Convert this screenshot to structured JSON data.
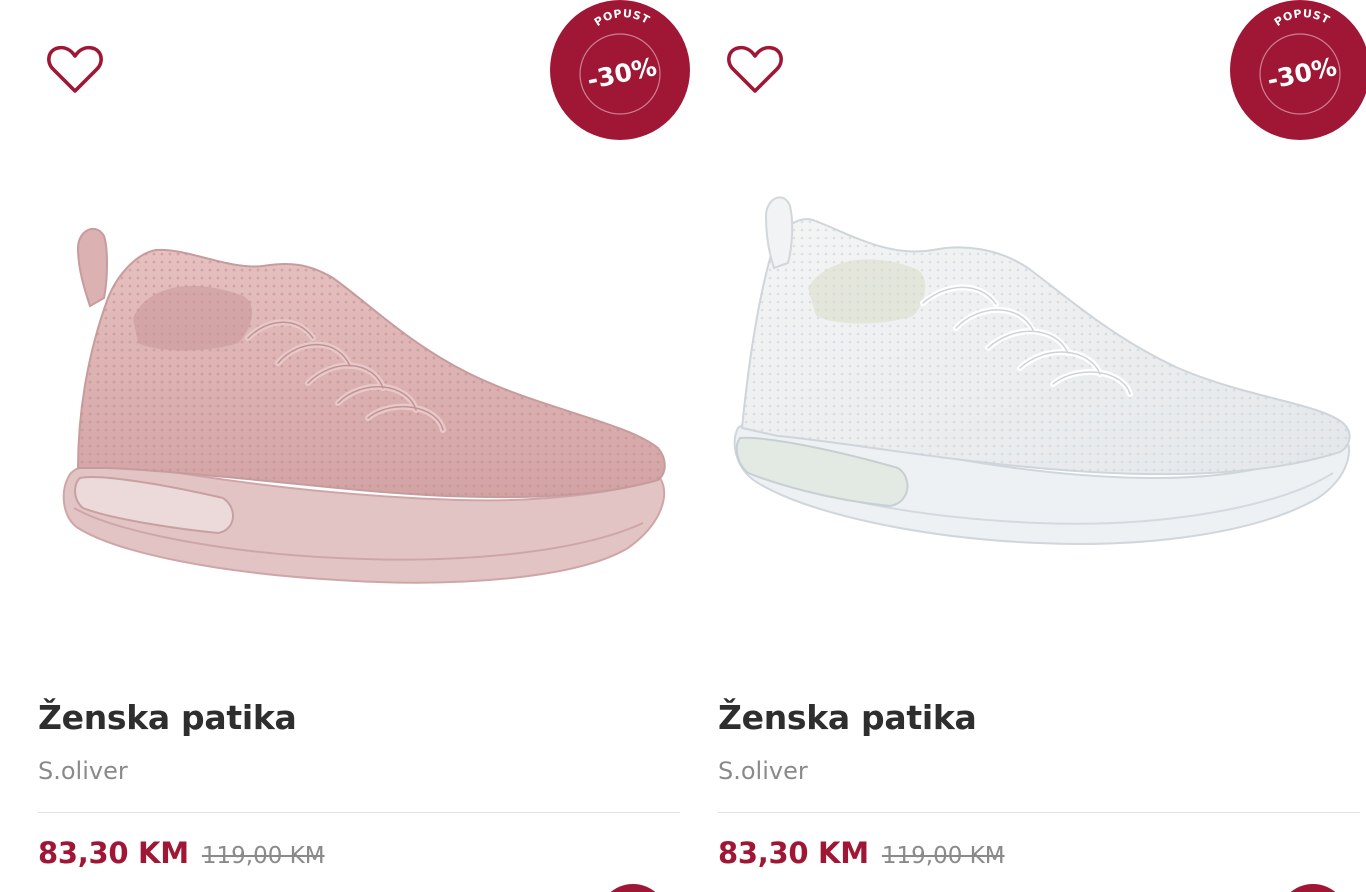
{
  "colors": {
    "accent": "#a01736",
    "title": "#2e2e2e",
    "muted": "#8a8a8a"
  },
  "products": [
    {
      "title": "Ženska patika",
      "brand": "S.oliver",
      "price_now": "83,30 KM",
      "price_old": "119,00 KM",
      "badge_label": "POPUST",
      "badge_value": "-30%",
      "favorite_icon": "heart-outline-icon",
      "image": "pink-knit-sneaker"
    },
    {
      "title": "Ženska patika",
      "brand": "S.oliver",
      "price_now": "83,30 KM",
      "price_old": "119,00 KM",
      "badge_label": "POPUST",
      "badge_value": "-30%",
      "favorite_icon": "heart-outline-icon",
      "image": "white-knit-sneaker"
    }
  ]
}
